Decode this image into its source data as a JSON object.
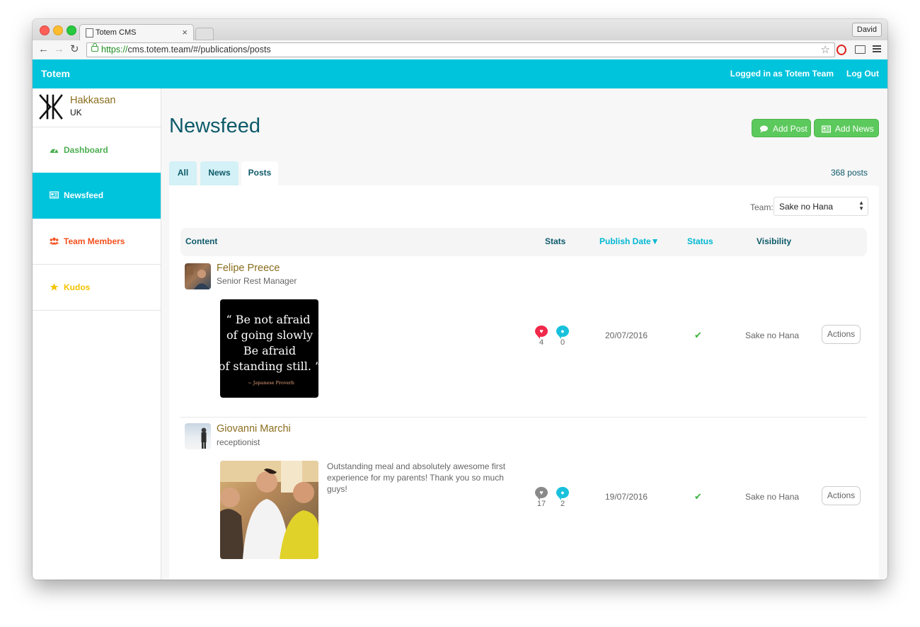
{
  "browser": {
    "tab_title": "Totem CMS",
    "tab_close": "×",
    "profile_name": "David",
    "url_scheme": "https://",
    "url_rest": "cms.totem.team/#/publications/posts"
  },
  "header": {
    "brand": "Totem",
    "logged_in": "Logged in as Totem Team",
    "logout": "Log Out",
    "color": "#00c3dc"
  },
  "sidebar": {
    "org_name": "Hakkasan",
    "org_country": "UK",
    "items": [
      {
        "label": "Dashboard",
        "icon": "dashboard-icon",
        "color": "#4caf50"
      },
      {
        "label": "Newsfeed",
        "icon": "newspaper-icon",
        "color": "#ffffff",
        "active": true
      },
      {
        "label": "Team Members",
        "icon": "users-icon",
        "color": "#f4511e"
      },
      {
        "label": "Kudos",
        "icon": "star-icon",
        "color": "#f5c400"
      }
    ]
  },
  "main": {
    "title": "Newsfeed",
    "add_post": "Add Post",
    "add_news": "Add News",
    "tabs": [
      {
        "label": "All",
        "active": false
      },
      {
        "label": "News",
        "active": false
      },
      {
        "label": "Posts",
        "active": true
      }
    ],
    "count": "368 posts",
    "team_label": "Team:",
    "team_value": "Sake no Hana"
  },
  "table": {
    "columns": {
      "content": "Content",
      "stats": "Stats",
      "publish_date": "Publish Date▼",
      "status": "Status",
      "visibility": "Visibility"
    },
    "rows": [
      {
        "author": "Felipe Preece",
        "role": "Senior Rest Manager",
        "text": "",
        "quote": {
          "line1": "“ Be not afraid",
          "line2": "of going slowly",
          "line3": "Be afraid",
          "line4": "of standing still. ”",
          "attribution": "~ Japanese Proverb"
        },
        "likes": "4",
        "comments": "0",
        "liked": true,
        "date": "20/07/2016",
        "status": "✔",
        "visibility": "Sake no Hana",
        "actions": "Actions"
      },
      {
        "author": "Giovanni Marchi",
        "role": "receptionist",
        "text": "Outstanding meal and absolutely awesome first experience for my parents! Thank you so much guys!",
        "likes": "17",
        "comments": "2",
        "liked": false,
        "date": "19/07/2016",
        "status": "✔",
        "visibility": "Sake no Hana",
        "actions": "Actions"
      }
    ]
  }
}
